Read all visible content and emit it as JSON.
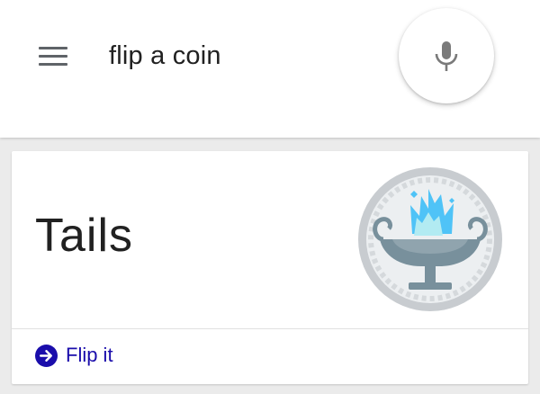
{
  "search": {
    "query": "flip a coin",
    "menu_icon": "hamburger-menu-icon",
    "mic_icon": "microphone-icon"
  },
  "result": {
    "text": "Tails",
    "coin_image": "coin-tails-flaming-chalice"
  },
  "action": {
    "label": "Flip it",
    "icon": "arrow-right-circle-icon"
  },
  "colors": {
    "page_background": "#ebebeb",
    "card_background": "#ffffff",
    "text_primary": "#212121",
    "link": "#1a0dab",
    "icon_gray": "#5f6368",
    "flame_blue": "#4fc3f7",
    "flame_light": "#b2ebf2",
    "chalice_gray": "#78909c"
  }
}
